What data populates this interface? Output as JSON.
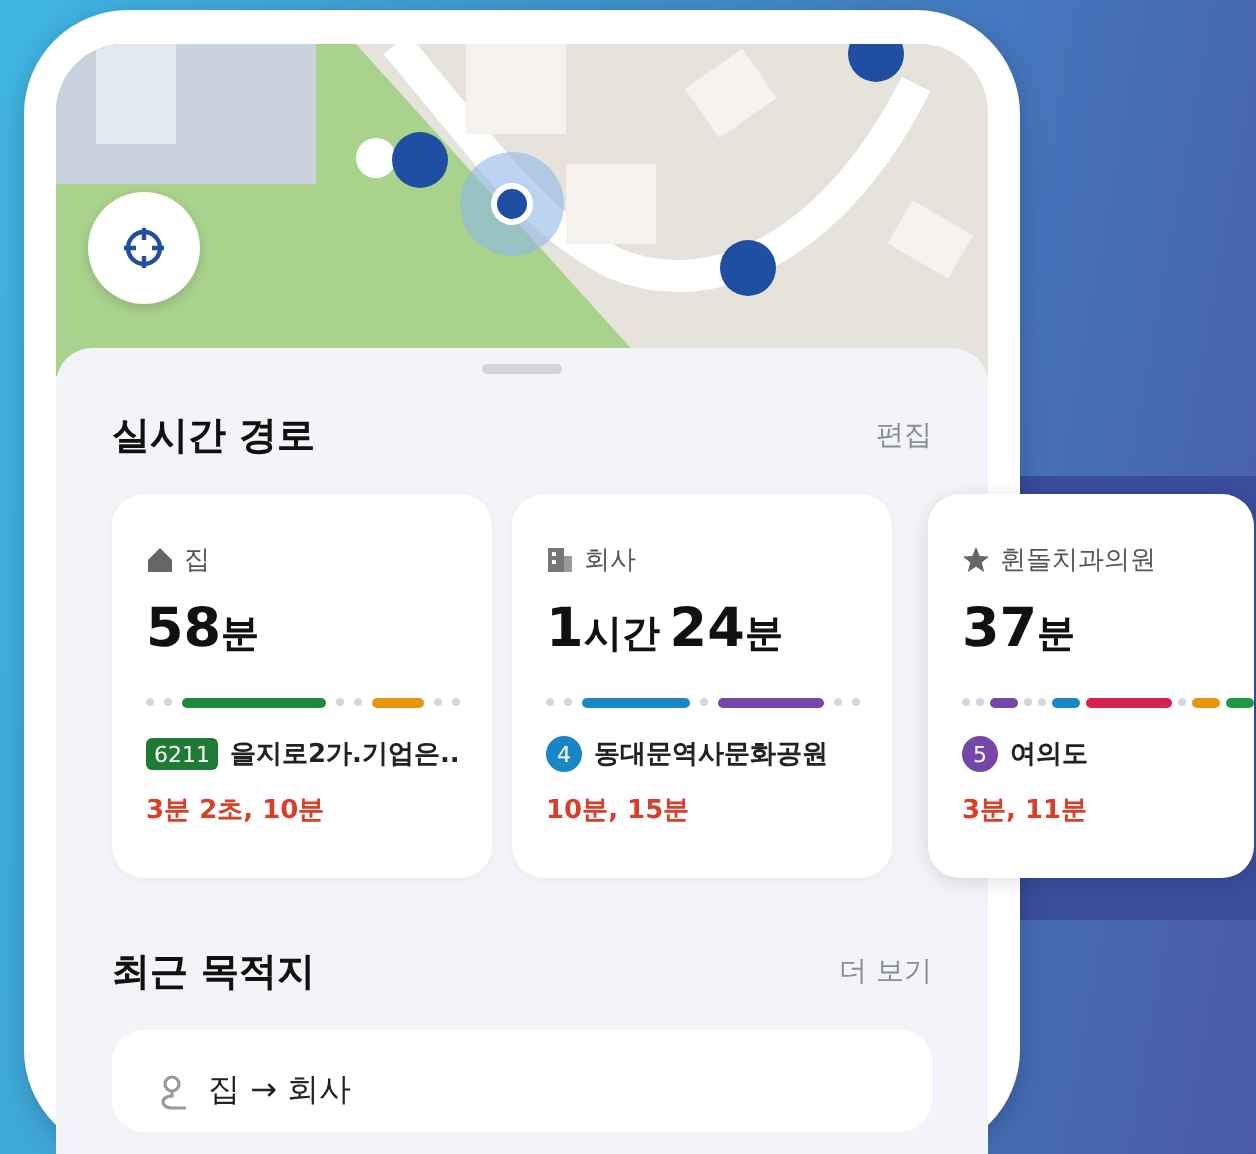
{
  "live_routes": {
    "title": "실시간 경로",
    "action": "편집",
    "cards": [
      {
        "place": "집",
        "duration_parts": [
          {
            "number": "58",
            "unit": "분"
          }
        ],
        "segments": [
          {
            "kind": "dot"
          },
          {
            "kind": "dot"
          },
          {
            "kind": "long",
            "color": "#1e8a3c"
          },
          {
            "kind": "dot"
          },
          {
            "kind": "dot"
          },
          {
            "kind": "short",
            "color": "#e8940c"
          },
          {
            "kind": "dot"
          },
          {
            "kind": "dot"
          }
        ],
        "line_badge": {
          "kind": "bus",
          "text": "6211",
          "color": "#1e7a34"
        },
        "stop": "을지로2가.기업은..",
        "arrivals": "3분 2초, 10분"
      },
      {
        "place": "회사",
        "duration_parts": [
          {
            "number": "1",
            "unit": "시간"
          },
          {
            "number": "24",
            "unit": "분"
          }
        ],
        "segments": [
          {
            "kind": "dot"
          },
          {
            "kind": "dot"
          },
          {
            "kind": "long",
            "color": "#1a86c8"
          },
          {
            "kind": "dot"
          },
          {
            "kind": "long",
            "color": "#7547a8"
          },
          {
            "kind": "dot"
          },
          {
            "kind": "dot"
          }
        ],
        "line_badge": {
          "kind": "subway",
          "text": "4",
          "color": "#1a86c8"
        },
        "stop": "동대문역사문화공원",
        "arrivals": "10분, 15분"
      },
      {
        "place": "휜돌치과의원",
        "duration_parts": [
          {
            "number": "37",
            "unit": "분"
          }
        ],
        "segments": [
          {
            "kind": "dot"
          },
          {
            "kind": "dot"
          },
          {
            "kind": "short",
            "color": "#7547a8"
          },
          {
            "kind": "dot"
          },
          {
            "kind": "dot"
          },
          {
            "kind": "short",
            "color": "#1a86c8"
          },
          {
            "kind": "long",
            "color": "#d8224e"
          },
          {
            "kind": "dot"
          },
          {
            "kind": "short",
            "color": "#e8940c"
          },
          {
            "kind": "short",
            "color": "#1e9a40"
          }
        ],
        "line_badge": {
          "kind": "subway",
          "text": "5",
          "color": "#7547a8"
        },
        "stop": "여의도",
        "arrivals": "3분, 11분"
      }
    ]
  },
  "recent": {
    "title": "최근 목적지",
    "action": "더 보기",
    "items": [
      {
        "text": "집 → 회사"
      }
    ]
  }
}
